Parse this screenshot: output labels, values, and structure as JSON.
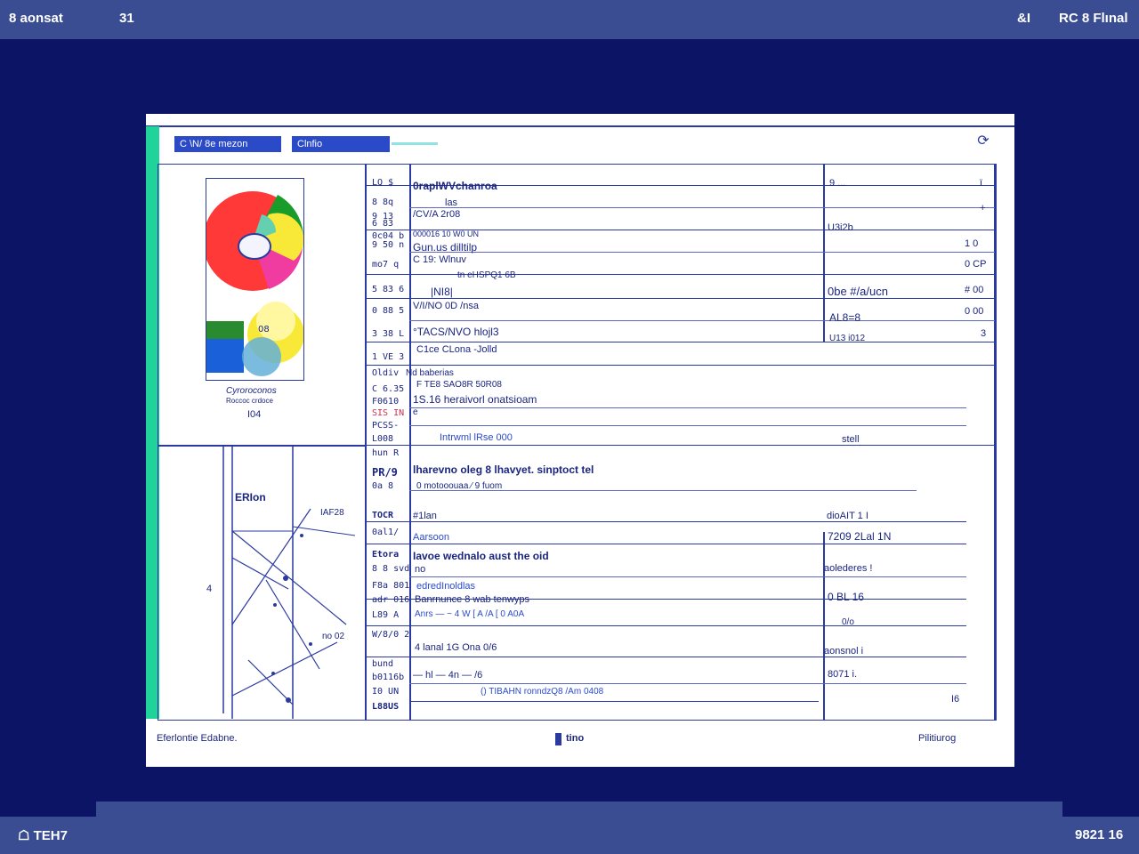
{
  "topbar": {
    "left_title": "8 aonsat",
    "left_num": "31",
    "right_a": "&I",
    "right_b": "RC 8 Flınal"
  },
  "bottombar": {
    "left": "☖ TEH7",
    "right": "9821 16"
  },
  "doc": {
    "tabs": [
      {
        "label": "C  \\N/ 8e mezon"
      },
      {
        "label": "Clnfio"
      }
    ],
    "rows": [
      {
        "code": "LQ $",
        "text": "0raplWVchanroa",
        "right": "9  ...",
        "mark": "ï"
      },
      {
        "code": "8 8q",
        "text": "las",
        "right": "",
        "mark": ""
      },
      {
        "code": "9 13",
        "text": "/CV/A 2r08",
        "right": "",
        "mark": "+"
      },
      {
        "code": "6 83",
        "text": "",
        "right": "U3i2b",
        "mark": ""
      },
      {
        "code": "0c04 b",
        "text": "000016 10 W0 UN",
        "right": "",
        "mark": ""
      },
      {
        "code": "9 50 n",
        "text": "Gun.us   dilltilp",
        "right": "",
        "mark": "1 0"
      },
      {
        "code": "mo7 q",
        "text": "C 19: Wlnuv",
        "right": "",
        "mark": "0 CP"
      },
      {
        "code": "",
        "text": "tn eHSPQ1 6B",
        "right": "",
        "mark": ""
      },
      {
        "code": "5 83 6",
        "text": "|NI8|",
        "right": "0be #/a/ucn",
        "mark": "# 00"
      },
      {
        "code": "0 88 5",
        "text": "V/I/NO 0D /nsa",
        "right": "",
        "mark": "0 00"
      },
      {
        "code": "",
        "text": "",
        "right": "AL8=8",
        "mark": ""
      },
      {
        "code": "3 38 L",
        "text": "°TACS/NVO hlojl3",
        "right": "",
        "mark": "3"
      },
      {
        "code": "1 VE 3",
        "text": "C1ce CLona -Jolld",
        "right": "U13 i012",
        "mark": ""
      }
    ],
    "mid": [
      {
        "code": "Oldiv",
        "text": "Nd baberias"
      },
      {
        "code": "C 6.35",
        "text": "F TE8 SAO8R 50R08"
      },
      {
        "code": "F0610",
        "text": "1S.16 heraivorl onatsioam"
      },
      {
        "code": "SIS IN",
        "text": "e"
      },
      {
        "code": "PCSS-",
        "text": ""
      },
      {
        "code": "L008",
        "text": "Intrwml       lRse 000",
        "right": "stell"
      }
    ],
    "sections": [
      {
        "code": "hun R",
        "text": ""
      },
      {
        "code": "PR/9",
        "text": "lharevno oleg 8 lhavyet. sinptoct tel",
        "right": ""
      },
      {
        "code": "0a 8",
        "text": "0 motooouaa         ⁄ 9 fuom"
      },
      {
        "code": "TOCR",
        "text": "#1lan",
        "right": "dioAIT 1 I"
      },
      {
        "code": "0al1/",
        "text": "Aarsoon",
        "right": "7209      2Lal 1N"
      },
      {
        "code": "Etora",
        "text": "Iavoe wednalo  aust the oid"
      },
      {
        "code": "8 8 svd",
        "text": "no",
        "right": "aolederes !"
      },
      {
        "code": "F8a 8015",
        "text": "edredInoldlas"
      },
      {
        "code": "adr 016",
        "text": "Banrnunce 8 wab tenwyps",
        "right": "0 BL          16"
      },
      {
        "code": "L89 A",
        "text": "Anrs  —   ~ 4  W  [ A /A  [ 0 A0A",
        "right": "0/o"
      },
      {
        "code": "W/8/0 2",
        "text": "4     lanal         1G Ona     0/6",
        "right": "aonsnol i"
      },
      {
        "code": "bund",
        "text": ""
      },
      {
        "code": "b0116b",
        "text": "—  hl  —  4n  —  /6",
        "right": "8071 i."
      },
      {
        "code": "I0 UN",
        "text": "() TIBAHN ronndzQ8  /Am 0408",
        "right": "I6"
      },
      {
        "code": "L88US",
        "text": ""
      }
    ],
    "chart_caption": "Cyroroconos",
    "chart_caption2": "Roccoc crdoce",
    "chart_caption3": "I04",
    "chart_center": "08",
    "diagram_label_a": "ERIon",
    "diagram_label_b": "IAF28",
    "diagram_label_c": "4",
    "diagram_label_d": "no 02",
    "footer": {
      "left": "Eferlontie Edabne.",
      "center": "tino",
      "right": "Pilitiurog"
    }
  }
}
